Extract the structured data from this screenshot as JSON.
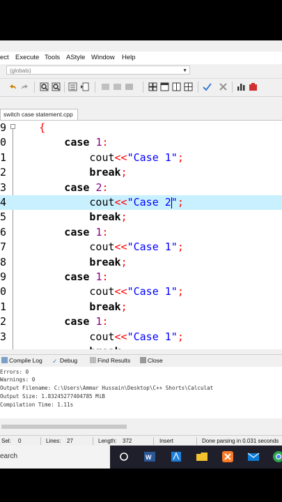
{
  "menu": [
    "ect",
    "Execute",
    "Tools",
    "AStyle",
    "Window",
    "Help"
  ],
  "globals_dropdown": "(globals)",
  "file_tab": "switch case statement.cpp",
  "code_lines": [
    {
      "n": "9",
      "parts": [
        [
          "brace",
          "{"
        ]
      ],
      "indent": 6
    },
    {
      "n": "0",
      "parts": [
        [
          "kw",
          "case"
        ],
        [
          "id",
          " "
        ],
        [
          "num",
          "1"
        ],
        [
          "op",
          ":"
        ]
      ],
      "indent": 10
    },
    {
      "n": "1",
      "parts": [
        [
          "id",
          "cout"
        ],
        [
          "op",
          "<<"
        ],
        [
          "str",
          "\"Case 1\""
        ],
        [
          "op",
          ";"
        ]
      ],
      "indent": 14
    },
    {
      "n": "2",
      "parts": [
        [
          "kw",
          "break"
        ],
        [
          "op",
          ";"
        ]
      ],
      "indent": 14
    },
    {
      "n": "3",
      "parts": [
        [
          "kw",
          "case"
        ],
        [
          "id",
          " "
        ],
        [
          "num",
          "2"
        ],
        [
          "op",
          ":"
        ]
      ],
      "indent": 10
    },
    {
      "n": "4",
      "parts": [
        [
          "id",
          "cout"
        ],
        [
          "op",
          "<<"
        ],
        [
          "str",
          "\"Case 2\""
        ],
        [
          "op",
          ";"
        ]
      ],
      "indent": 14,
      "highlight": true
    },
    {
      "n": "5",
      "parts": [
        [
          "kw",
          "break"
        ],
        [
          "op",
          ";"
        ]
      ],
      "indent": 14
    },
    {
      "n": "6",
      "parts": [
        [
          "kw",
          "case"
        ],
        [
          "id",
          " "
        ],
        [
          "num",
          "1"
        ],
        [
          "op",
          ":"
        ]
      ],
      "indent": 10
    },
    {
      "n": "7",
      "parts": [
        [
          "id",
          "cout"
        ],
        [
          "op",
          "<<"
        ],
        [
          "str",
          "\"Case 1\""
        ],
        [
          "op",
          ";"
        ]
      ],
      "indent": 14
    },
    {
      "n": "8",
      "parts": [
        [
          "kw",
          "break"
        ],
        [
          "op",
          ";"
        ]
      ],
      "indent": 14
    },
    {
      "n": "9",
      "parts": [
        [
          "kw",
          "case"
        ],
        [
          "id",
          " "
        ],
        [
          "num",
          "1"
        ],
        [
          "op",
          ":"
        ]
      ],
      "indent": 10
    },
    {
      "n": "0",
      "parts": [
        [
          "id",
          "cout"
        ],
        [
          "op",
          "<<"
        ],
        [
          "str",
          "\"Case 1\""
        ],
        [
          "op",
          ";"
        ]
      ],
      "indent": 14
    },
    {
      "n": "1",
      "parts": [
        [
          "kw",
          "break"
        ],
        [
          "op",
          ";"
        ]
      ],
      "indent": 14
    },
    {
      "n": "2",
      "parts": [
        [
          "kw",
          "case"
        ],
        [
          "id",
          " "
        ],
        [
          "num",
          "1"
        ],
        [
          "op",
          ":"
        ]
      ],
      "indent": 10
    },
    {
      "n": "3",
      "parts": [
        [
          "id",
          "cout"
        ],
        [
          "op",
          "<<"
        ],
        [
          "str",
          "\"Case 1\""
        ],
        [
          "op",
          ";"
        ]
      ],
      "indent": 14
    },
    {
      "n": "",
      "parts": [
        [
          "kw",
          "break"
        ]
      ],
      "indent": 14
    }
  ],
  "log_tabs": [
    "Compile Log",
    "Debug",
    "Find Results",
    "Close"
  ],
  "log_lines": [
    "Errors: 0",
    "Warnings: 0",
    "Output Filename: C:\\Users\\Ammar Hussain\\Desktop\\C++ Shorts\\Calculat",
    "Output Size: 1.83245277404785 MiB",
    "Compilation Time: 1.11s"
  ],
  "status": {
    "sel_label": "Sel:",
    "sel_value": "0",
    "lines_label": "Lines:",
    "lines_value": "27",
    "length_label": "Length:",
    "length_value": "372",
    "mode": "Insert",
    "message": "Done parsing in 0.031 seconds"
  },
  "taskbar": {
    "search_text": "earch"
  },
  "colors": {
    "highlight_line": "#c9f0ff",
    "string": "#0000ff",
    "operator": "#ff0000",
    "number": "#800080"
  }
}
